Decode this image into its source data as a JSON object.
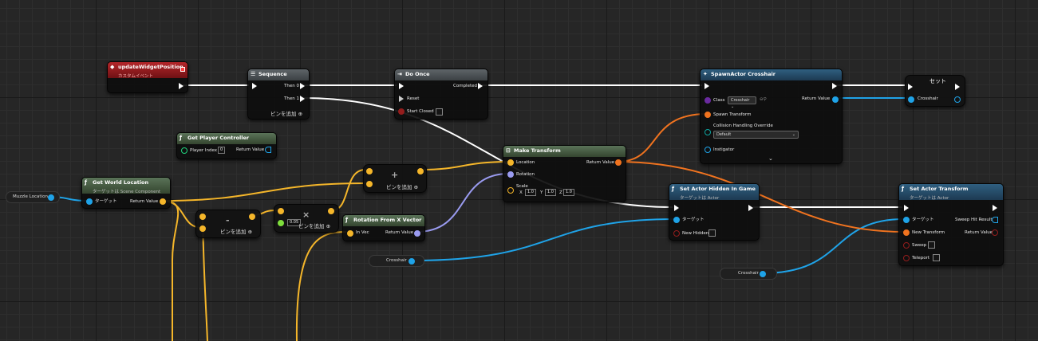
{
  "colors": {
    "exec": "#ffffff",
    "object": "#1fa3e8",
    "vector": "#f5b62a",
    "transform": "#f0731f",
    "rotator": "#9a9bf0",
    "bool": "#941d1d",
    "class": "#6a2aa0",
    "struct": "#0fa4a0",
    "int": "#21d37d",
    "float": "#7fdf3c"
  },
  "nodes": {
    "update_widget": {
      "title": "updateWidgetPosition",
      "subtitle": "カスタムイベント"
    },
    "sequence": {
      "title": "Sequence",
      "then0": "Then 0",
      "then1": "Then 1",
      "add_pin": "ピンを追加"
    },
    "do_once": {
      "title": "Do Once",
      "completed": "Completed",
      "reset": "Reset",
      "start_closed": "Start Closed"
    },
    "spawn_actor": {
      "title": "SpawnActor Crosshair",
      "class_label": "Class",
      "class_value": "Crosshair",
      "return_value": "Return Value",
      "spawn_transform": "Spawn Transform",
      "collision": "Collision Handling Override",
      "collision_value": "Default",
      "instigator": "Instigator"
    },
    "set_node": {
      "title": "セット",
      "crosshair": "Crosshair"
    },
    "get_player_controller": {
      "title": "Get Player Controller",
      "player_index": "Player Index",
      "player_index_value": "0",
      "return_value": "Return Value"
    },
    "make_transform": {
      "title": "Make Transform",
      "location": "Location",
      "rotation": "Rotation",
      "scale": "Scale",
      "return_value": "Return Value",
      "scale_x_label": "X",
      "scale_y_label": "Y",
      "scale_z_label": "Z",
      "scale_x": "1.0",
      "scale_y": "1.0",
      "scale_z": "1.0"
    },
    "get_world_location": {
      "title": "Get World Location",
      "subtitle": "ターゲットは Scene Component",
      "target": "ターゲット",
      "return_value": "Return Value"
    },
    "add_node": {
      "symbol": "+",
      "add_pin": "ピンを追加"
    },
    "subtract_node": {
      "symbol": "-",
      "add_pin": "ピンを追加"
    },
    "multiply_node": {
      "symbol": "×",
      "add_pin": "ピンを追加",
      "value": "0.05"
    },
    "rotation_from_x": {
      "title": "Rotation From X Vector",
      "in_vec": "In Vec",
      "return_value": "Return Value"
    },
    "set_actor_hidden": {
      "title": "Set Actor Hidden In Game",
      "subtitle": "ターゲットは Actor",
      "target": "ターゲット",
      "new_hidden": "New Hidden"
    },
    "set_actor_transform": {
      "title": "Set Actor Transform",
      "subtitle": "ターゲットは Actor",
      "target": "ターゲット",
      "sweep_hit": "Sweep Hit Result",
      "new_transform": "New Transform",
      "return_value": "Return Value",
      "sweep": "Sweep",
      "teleport": "Teleport"
    }
  },
  "variables": {
    "muzzle_location": "Muzzle Location",
    "crosshair_1": "Crosshair",
    "crosshair_2": "Crosshair"
  }
}
